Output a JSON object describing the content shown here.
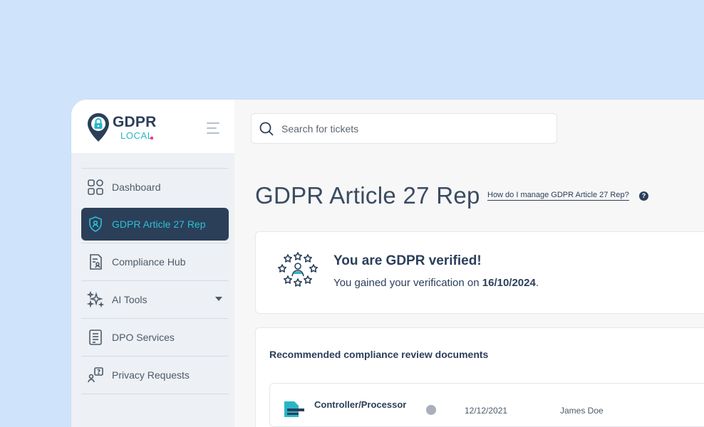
{
  "brand": {
    "name": "GDPR",
    "sub": "LOCAL",
    "colors": {
      "navy": "#2b3f59",
      "teal": "#2bc0d6",
      "pink": "#e8457b",
      "background": "#cfe3fb"
    }
  },
  "search": {
    "placeholder": "Search for tickets",
    "icon": "search-icon"
  },
  "sidebar": {
    "items": [
      {
        "label": "Dashboard",
        "icon": "dashboard-grid-icon",
        "active": false
      },
      {
        "label": "GDPR Article 27 Rep",
        "icon": "shield-user-icon",
        "active": true
      },
      {
        "label": "Compliance Hub",
        "icon": "document-user-icon",
        "active": false
      },
      {
        "label": "AI Tools",
        "icon": "sparkles-icon",
        "active": false,
        "expandable": true
      },
      {
        "label": "DPO Services",
        "icon": "clipboard-list-icon",
        "active": false
      },
      {
        "label": "Privacy Requests",
        "icon": "user-question-icon",
        "active": false
      }
    ]
  },
  "main": {
    "title": "GDPR Article 27 Rep",
    "help_link": "How do I manage GDPR Article 27 Rep?",
    "verified": {
      "title": "You are GDPR verified!",
      "text_prefix": "You gained your verification on ",
      "date": "16/10/2024",
      "text_suffix": "."
    },
    "documents": {
      "title": "Recommended compliance review documents",
      "rows": [
        {
          "name": "Controller/Processor",
          "date": "12/12/2021",
          "owner": "James Doe"
        }
      ]
    }
  }
}
